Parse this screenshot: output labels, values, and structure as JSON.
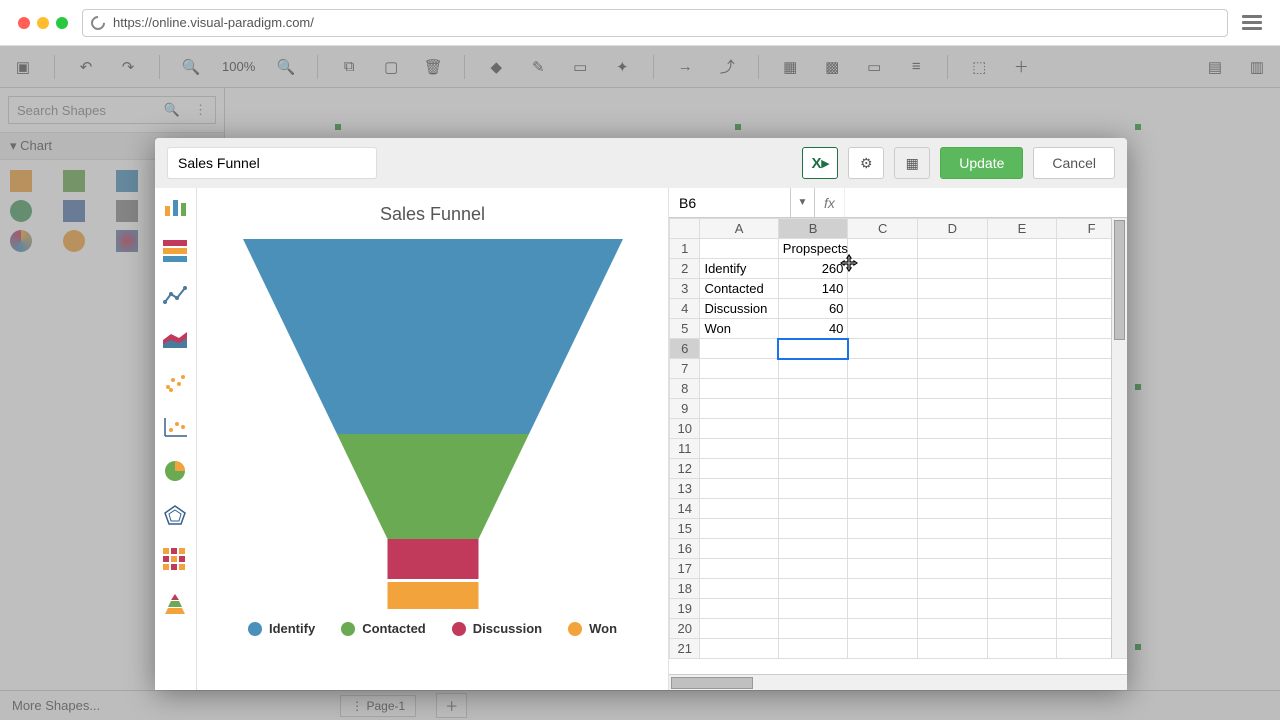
{
  "browser": {
    "url": "https://online.visual-paradigm.com/"
  },
  "toolbar": {
    "zoom": "100%"
  },
  "sidebar": {
    "search_placeholder": "Search Shapes",
    "section_chart": "Chart",
    "more_shapes": "More Shapes..."
  },
  "pages": {
    "tab1": "Page-1"
  },
  "dialog": {
    "title_input": "Sales Funnel",
    "update": "Update",
    "cancel": "Cancel",
    "preview_title": "Sales Funnel",
    "legend": [
      "Identify",
      "Contacted",
      "Discussion",
      "Won"
    ],
    "colors": {
      "identify": "#4a90b8",
      "contacted": "#6aaa52",
      "discussion": "#c1395b",
      "won": "#f2a33c"
    },
    "cell_ref": "B6",
    "fx_label": "fx",
    "sheet": {
      "columns": [
        "A",
        "B",
        "C",
        "D",
        "E",
        "F"
      ],
      "rows": 21,
      "selected": "B6",
      "data": {
        "B1": "Propspects",
        "A2": "Identify",
        "B2": "260",
        "A3": "Contacted",
        "B3": "140",
        "A4": "Discussion",
        "B4": "60",
        "A5": "Won",
        "B5": "40"
      }
    }
  },
  "chart_data": {
    "type": "funnel",
    "title": "Sales Funnel",
    "series_name": "Propspects",
    "categories": [
      "Identify",
      "Contacted",
      "Discussion",
      "Won"
    ],
    "values": [
      260,
      140,
      60,
      40
    ],
    "colors": [
      "#4a90b8",
      "#6aaa52",
      "#c1395b",
      "#f2a33c"
    ]
  }
}
